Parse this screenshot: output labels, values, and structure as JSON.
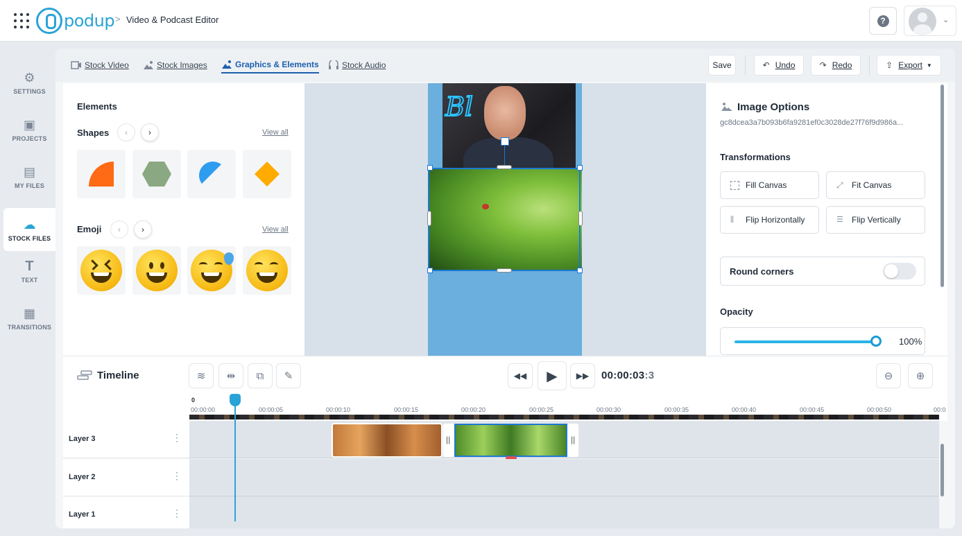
{
  "header": {
    "logo_text": "podup",
    "breadcrumb_sep": ">",
    "app_title": "Video & Podcast Editor",
    "help_glyph": "?"
  },
  "sidebar": {
    "items": [
      {
        "label": "SETTINGS",
        "icon": "gear-icon",
        "glyph": "⚙"
      },
      {
        "label": "PROJECTS",
        "icon": "projects-icon",
        "glyph": "▣"
      },
      {
        "label": "MY FILES",
        "icon": "folder-icon",
        "glyph": "▤"
      },
      {
        "label": "STOCK FILES",
        "icon": "cloud-icon",
        "glyph": "☁"
      },
      {
        "label": "TEXT",
        "icon": "text-icon",
        "glyph": "T"
      },
      {
        "label": "TRANSITIONS",
        "icon": "transitions-icon",
        "glyph": "▦"
      }
    ],
    "active": "STOCK FILES"
  },
  "tabs": {
    "items": [
      "Stock Video",
      "Stock Images",
      "Graphics & Elements",
      "Stock Audio"
    ],
    "active": "Graphics & Elements"
  },
  "toolbar": {
    "save": "Save",
    "undo": "Undo",
    "redo": "Redo",
    "export": "Export"
  },
  "elements": {
    "title": "Elements",
    "shapes_title": "Shapes",
    "emoji_title": "Emoji",
    "view_all": "View all",
    "shapes": [
      "quarter-circle-shape",
      "hexagon-shape",
      "half-circle-shape",
      "diamond-shape"
    ],
    "shape_colors": [
      "#ff6a14",
      "#8aa882",
      "#2e9cef",
      "#ffab00"
    ]
  },
  "image_options": {
    "title": "Image Options",
    "id": "gc8dcea3a7b093b6fa9281ef0c3028de27f76f9d986a...",
    "transformations_title": "Transformations",
    "buttons": [
      "Fill Canvas",
      "Fit Canvas",
      "Flip Horizontally",
      "Flip Vertically"
    ],
    "round_corners": "Round corners",
    "round_corners_on": false,
    "opacity_title": "Opacity",
    "opacity_value": "100%",
    "opacity": 1.0
  },
  "timeline": {
    "title": "Timeline",
    "time_main": "00:00:03",
    "time_frac": ":3",
    "ruler_zero": "0",
    "ruler_labels": [
      "00:00:00",
      "00:00:05",
      "00:00:10",
      "00:00:15",
      "00:00:20",
      "00:00:25",
      "00:00:30",
      "00:00:35",
      "00:00:40",
      "00:00:45",
      "00:00:50",
      "00:0"
    ],
    "layers": [
      "Layer 3",
      "Layer 2",
      "Layer 1"
    ],
    "delete_glyph": "✕",
    "grip_glyph": "||"
  },
  "colors": {
    "accent": "#29a3d6",
    "active_tab": "#1c5fae",
    "canvas_bg": "#6aafdd",
    "selection": "#1c78d4"
  }
}
